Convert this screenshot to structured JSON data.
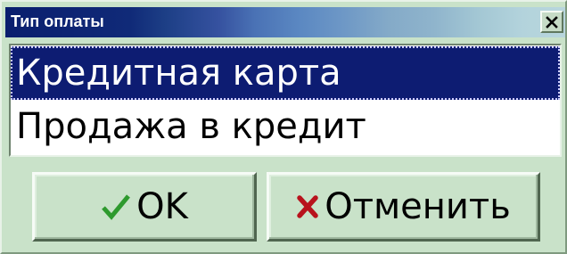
{
  "window": {
    "title": "Тип оплаты",
    "close_icon": "close-icon"
  },
  "list": {
    "selected_index": 0,
    "items": [
      {
        "label": "Кредитная карта"
      },
      {
        "label": "Продажа в кредит"
      }
    ]
  },
  "buttons": {
    "ok_label": "OK",
    "ok_icon": "checkmark-icon",
    "cancel_label": "Отменить",
    "cancel_icon": "cross-icon"
  },
  "colors": {
    "dialog_background": "#c9e2c9",
    "title_bar_start": "#0a1e6e",
    "title_bar_end": "#b8d6dd",
    "selection_background": "#0d1c72",
    "checkmark": "#2e9a2e",
    "cross": "#b8121c"
  }
}
